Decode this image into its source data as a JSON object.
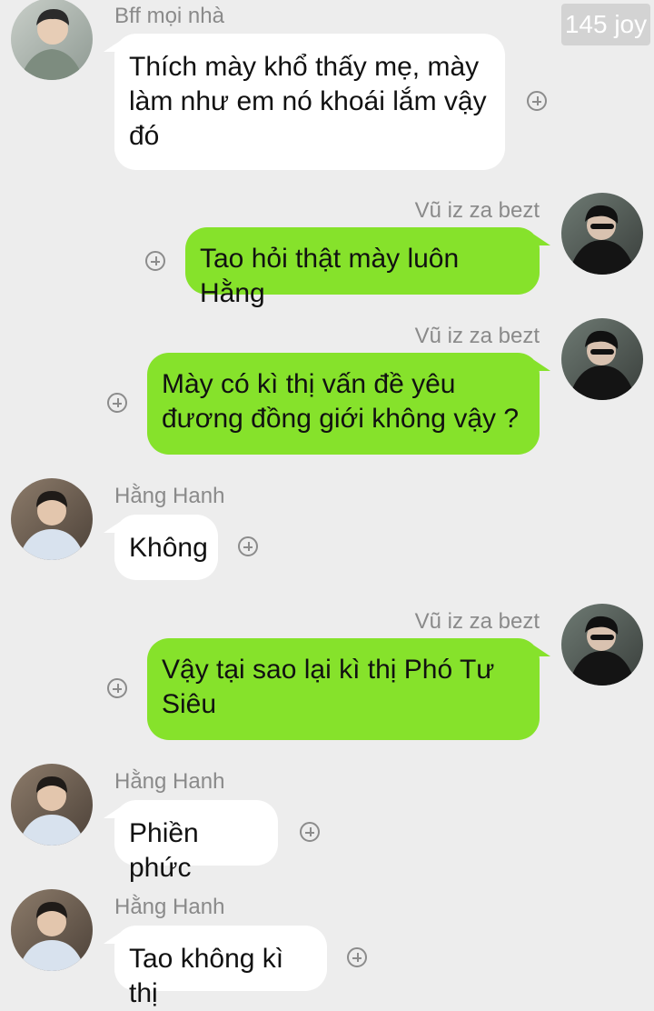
{
  "watermark": "145 joy",
  "icons": {
    "add_reaction": "plus-circle-icon"
  },
  "colors": {
    "background": "#ededed",
    "incoming_bubble": "#ffffff",
    "outgoing_bubble": "#86e22b",
    "sender_name": "#8a8a8a"
  },
  "messages": [
    {
      "sender": "Bff mọi nhà",
      "text": "Thích mày khổ thấy mẹ, mày làm như em nó khoái lắm vậy đó",
      "direction": "incoming"
    },
    {
      "sender": "Vũ iz za bezt",
      "text": "Tao hỏi thật mày luôn Hằng",
      "direction": "outgoing"
    },
    {
      "sender": "Vũ iz za bezt",
      "text": "Mày có kì thị vấn đề yêu đương đồng giới không vậy ?",
      "direction": "outgoing"
    },
    {
      "sender": "Hằng Hanh",
      "text": "Không",
      "direction": "incoming"
    },
    {
      "sender": "Vũ iz za bezt",
      "text": "Vậy tại sao lại kì thị Phó Tư Siêu",
      "direction": "outgoing"
    },
    {
      "sender": "Hằng Hanh",
      "text": "Phiền phức",
      "direction": "incoming"
    },
    {
      "sender": "Hằng Hanh",
      "text": "Tao không kì thị",
      "direction": "incoming"
    }
  ]
}
